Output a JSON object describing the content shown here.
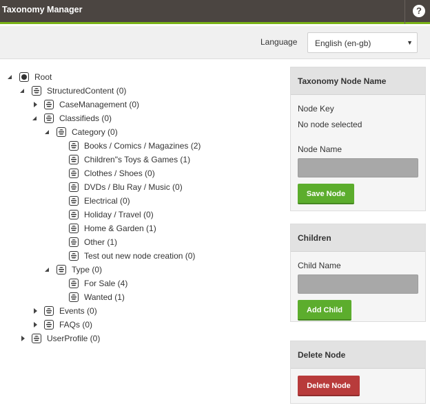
{
  "header": {
    "title": "Taxonomy Manager",
    "help_label": "?"
  },
  "language": {
    "label": "Language",
    "selected": "English (en-gb)"
  },
  "tree": [
    {
      "label": "Root",
      "expanded": true
    },
    {
      "label": "StructuredContent (0)",
      "expanded": true
    },
    {
      "label": "CaseManagement (0)",
      "expanded": false
    },
    {
      "label": "Classifieds (0)",
      "expanded": true
    },
    {
      "label": "Category (0)",
      "expanded": true
    },
    {
      "label": "Books / Comics / Magazines (2)"
    },
    {
      "label": "Children\"s Toys & Games (1)"
    },
    {
      "label": "Clothes / Shoes (0)"
    },
    {
      "label": "DVDs / Blu Ray / Music (0)"
    },
    {
      "label": "Electrical (0)"
    },
    {
      "label": "Holiday / Travel (0)"
    },
    {
      "label": "Home & Garden (1)"
    },
    {
      "label": "Other (1)"
    },
    {
      "label": "Test out new node creation (0)"
    },
    {
      "label": "Type (0)",
      "expanded": true
    },
    {
      "label": "For Sale (4)"
    },
    {
      "label": "Wanted (1)"
    },
    {
      "label": "Events (0)",
      "expanded": false
    },
    {
      "label": "FAQs (0)",
      "expanded": false
    },
    {
      "label": "UserProfile (0)",
      "expanded": false
    }
  ],
  "node_panel": {
    "heading": "Taxonomy Node Name",
    "key_label": "Node Key",
    "key_value": "No node selected",
    "name_label": "Node Name",
    "name_value": "",
    "save_label": "Save Node"
  },
  "children_panel": {
    "heading": "Children",
    "child_label": "Child Name",
    "child_value": "",
    "add_label": "Add Child"
  },
  "delete_panel": {
    "heading": "Delete Node",
    "delete_label": "Delete Node"
  }
}
